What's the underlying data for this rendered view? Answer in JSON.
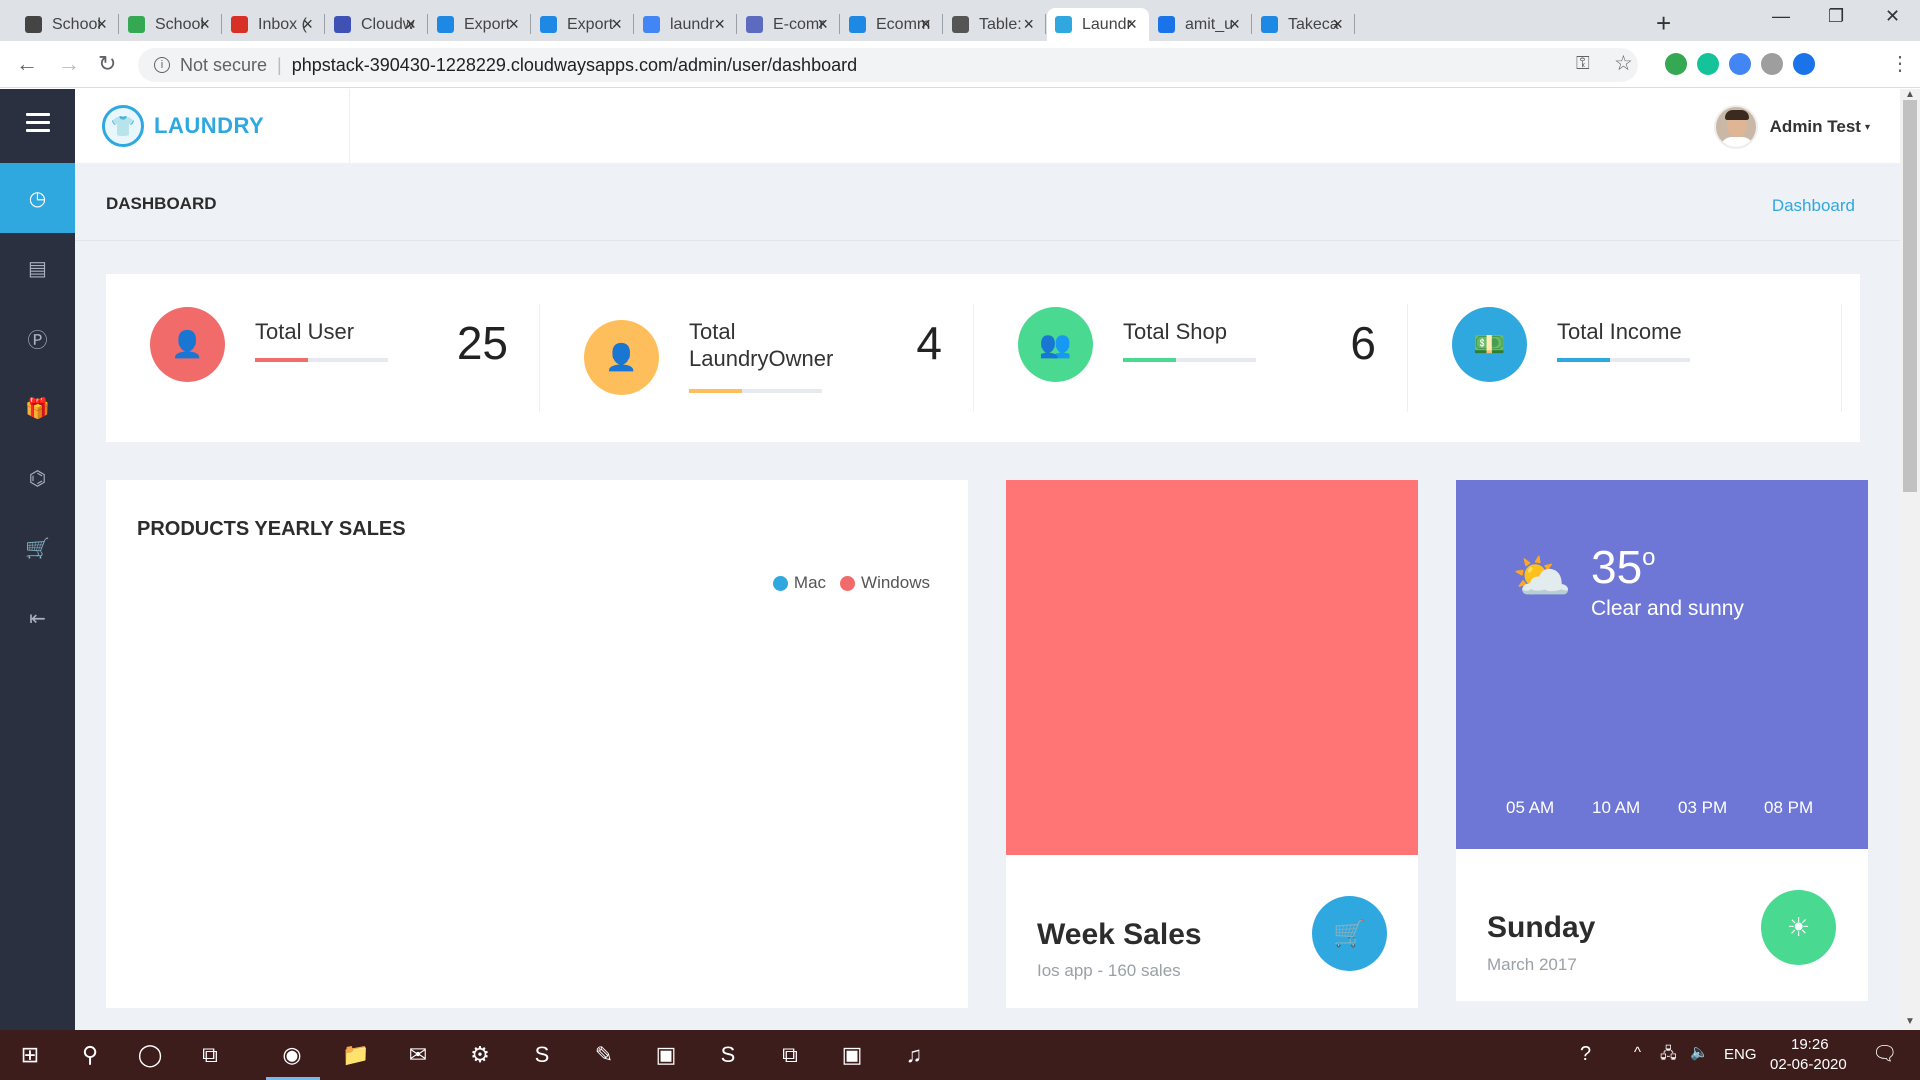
{
  "browser": {
    "tabs": [
      {
        "title": "School",
        "fav_color": "#444444",
        "active": false
      },
      {
        "title": "School",
        "fav_color": "#34a853",
        "active": false
      },
      {
        "title": "Inbox (",
        "fav_color": "#d93025",
        "active": false
      },
      {
        "title": "Cloudw",
        "fav_color": "#3f51b5",
        "active": false
      },
      {
        "title": "Export",
        "fav_color": "#1e88e5",
        "active": false
      },
      {
        "title": "Export",
        "fav_color": "#1e88e5",
        "active": false
      },
      {
        "title": "laundr",
        "fav_color": "#4285f4",
        "active": false
      },
      {
        "title": "E-comr",
        "fav_color": "#5c6bc0",
        "active": false
      },
      {
        "title": "Ecomm",
        "fav_color": "#1e88e5",
        "active": false
      },
      {
        "title": "Table:",
        "fav_color": "#555555",
        "active": false
      },
      {
        "title": "Laundr",
        "fav_color": "#2fa8e0",
        "active": true
      },
      {
        "title": "amit_u",
        "fav_color": "#1a73e8",
        "active": false
      },
      {
        "title": "Takeca",
        "fav_color": "#1e88e5",
        "active": false
      }
    ],
    "new_tab": "+",
    "window_controls": {
      "minimize": "—",
      "maximize": "❐",
      "close": "✕"
    },
    "nav": {
      "back": "←",
      "forward": "→",
      "reload": "↻"
    },
    "security": "Not secure",
    "url": "phpstack-390430-1228229.cloudwaysapps.com/admin/user/dashboard",
    "ext_colors": [
      "#34a853",
      "#15c39a",
      "#4285f4",
      "#9e9e9e",
      "#1a73e8"
    ],
    "bookmark_icon": "star-icon",
    "key_icon": "key-icon"
  },
  "sidebar": {
    "menu_icon": "hamburger-icon",
    "items": [
      {
        "icon": "dashboard-icon",
        "glyph": "◷",
        "active": true
      },
      {
        "icon": "table-icon",
        "glyph": "▤",
        "active": false
      },
      {
        "icon": "parking-icon",
        "glyph": "Ⓟ",
        "active": false
      },
      {
        "icon": "gift-icon",
        "glyph": "🎁",
        "active": false
      },
      {
        "icon": "tag-icon",
        "glyph": "⌬",
        "active": false
      },
      {
        "icon": "cart-icon",
        "glyph": "🛒",
        "active": false
      },
      {
        "icon": "logout-icon",
        "glyph": "⇤",
        "active": false
      }
    ]
  },
  "header": {
    "logo_text": "LAUNDRY",
    "logo_icon": "shirt-icon",
    "user_name": "Admin Test",
    "user_caret": "▾"
  },
  "page": {
    "title": "DASHBOARD",
    "breadcrumb": "Dashboard"
  },
  "stats": [
    {
      "label": "Total User",
      "value": "25",
      "color": "#f26b6b",
      "fill": 0.4,
      "icon": "user-icon",
      "glyph": "👤"
    },
    {
      "label": "Total LaundryOwner",
      "value": "4",
      "color": "#ffbe5c",
      "fill": 0.4,
      "icon": "user-icon",
      "glyph": "👤"
    },
    {
      "label": "Total Shop",
      "value": "6",
      "color": "#4ad991",
      "fill": 0.4,
      "icon": "users-icon",
      "glyph": "👥"
    },
    {
      "label": "Total Income",
      "value": "",
      "color": "#2fa8e0",
      "fill": 0.4,
      "icon": "money-icon",
      "glyph": "💵"
    }
  ],
  "chart": {
    "title": "PRODUCTS YEARLY SALES",
    "legend": [
      {
        "name": "Mac",
        "color": "#2fa8e0"
      },
      {
        "name": "Windows",
        "color": "#f26b6b"
      }
    ]
  },
  "week_sales": {
    "title": "Week Sales",
    "subtitle": "Ios app - 160 sales",
    "top_color": "#ff7575",
    "button_color": "#2fa8e0",
    "button_icon": "cart-icon"
  },
  "weather": {
    "temp": "35",
    "degree": "o",
    "description": "Clear and sunny",
    "icon": "cloud-sun-icon",
    "times": [
      "05 AM",
      "10 AM",
      "03 PM",
      "08 PM"
    ],
    "day": "Sunday",
    "date": "March 2017",
    "top_color": "#6e77d5",
    "button_color": "#4ad991",
    "button_icon": "sun-icon"
  },
  "taskbar": {
    "icons": [
      "windows-start-icon",
      "search-icon",
      "cortana-icon",
      "task-view-icon",
      "chrome-icon",
      "file-explorer-icon",
      "outlook-icon",
      "settings-icon",
      "skype-icon",
      "notepad-icon",
      "app-icon",
      "sublime-icon",
      "network-icon",
      "app-icon",
      "itunes-icon"
    ],
    "lang": "ENG",
    "time": "19:26",
    "date": "02-06-2020"
  }
}
